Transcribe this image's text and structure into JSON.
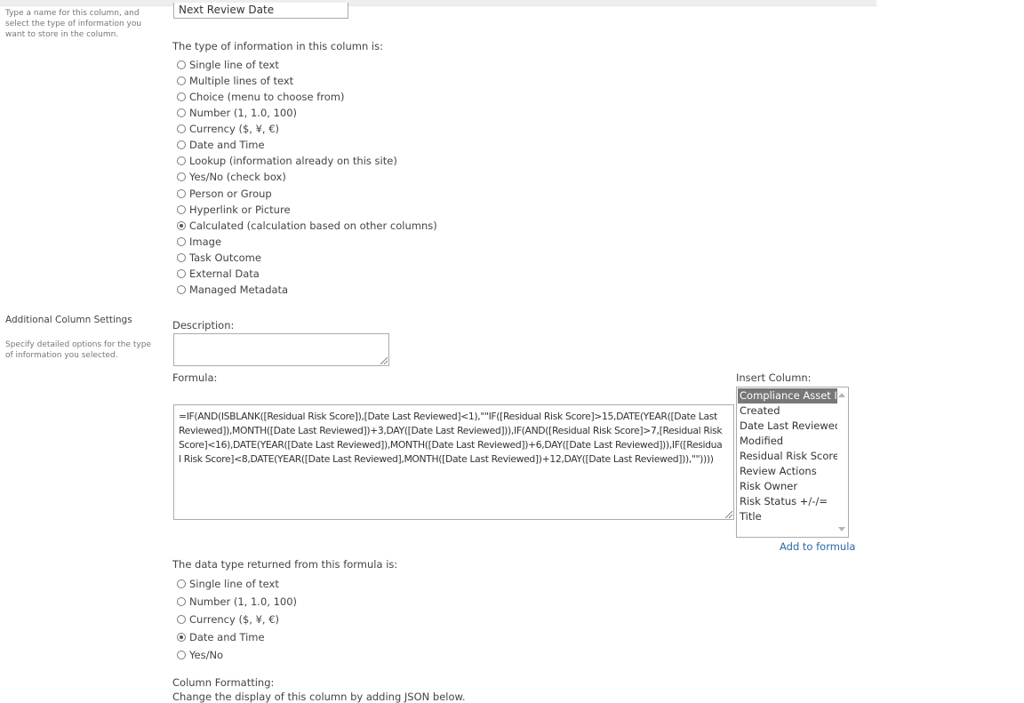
{
  "name_section": {
    "description": "Type a name for this column, and select the type of information you want to store in the column.",
    "column_name_value": "Next Review Date"
  },
  "type_section": {
    "label": "The type of information in this column is:",
    "options": [
      {
        "label": "Single line of text",
        "checked": false
      },
      {
        "label": "Multiple lines of text",
        "checked": false
      },
      {
        "label": "Choice (menu to choose from)",
        "checked": false
      },
      {
        "label": "Number (1, 1.0, 100)",
        "checked": false
      },
      {
        "label": "Currency ($, ¥, €)",
        "checked": false
      },
      {
        "label": "Date and Time",
        "checked": false
      },
      {
        "label": "Lookup (information already on this site)",
        "checked": false
      },
      {
        "label": "Yes/No (check box)",
        "checked": false
      },
      {
        "label": "Person or Group",
        "checked": false
      },
      {
        "label": "Hyperlink or Picture",
        "checked": false
      },
      {
        "label": "Calculated (calculation based on other columns)",
        "checked": true
      },
      {
        "label": "Image",
        "checked": false
      },
      {
        "label": "Task Outcome",
        "checked": false
      },
      {
        "label": "External Data",
        "checked": false
      },
      {
        "label": "Managed Metadata",
        "checked": false
      }
    ]
  },
  "additional_settings": {
    "heading": "Additional Column Settings",
    "description": "Specify detailed options for the type of information you selected.",
    "description_label": "Description:",
    "description_value": "",
    "formula_label": "Formula:",
    "formula_value": "=IF(AND(ISBLANK([Residual Risk Score]),[Date Last Reviewed]<1),\"\"IF([Residual Risk Score]>15,DATE(YEAR([Date Last Reviewed]),MONTH([Date Last Reviewed])+3,DAY([Date Last Reviewed])),IF(AND([Residual Risk Score]>7,[Residual Risk Score]<16),DATE(YEAR([Date Last Reviewed]),MONTH([Date Last Reviewed])+6,DAY([Date Last Reviewed])),IF([Residual Risk Score]<8,DATE(YEAR([Date Last Reviewed],MONTH([Date Last Reviewed])+12,DAY([Date Last Reviewed])),\"\"))))",
    "insert_column_label": "Insert Column:",
    "insert_columns": [
      {
        "label": "Compliance Asset Id",
        "selected": true
      },
      {
        "label": "Created",
        "selected": false
      },
      {
        "label": "Date Last Reviewed",
        "selected": false
      },
      {
        "label": "Modified",
        "selected": false
      },
      {
        "label": "Residual Risk Score",
        "selected": false
      },
      {
        "label": "Review Actions",
        "selected": false
      },
      {
        "label": "Risk Owner",
        "selected": false
      },
      {
        "label": "Risk Status +/-/=",
        "selected": false
      },
      {
        "label": "Title",
        "selected": false
      }
    ],
    "add_to_formula_link": "Add to formula",
    "return_type_label": "The data type returned from this formula is:",
    "return_types": [
      {
        "label": "Single line of text",
        "checked": false
      },
      {
        "label": "Number (1, 1.0, 100)",
        "checked": false
      },
      {
        "label": "Currency ($, ¥, €)",
        "checked": false
      },
      {
        "label": "Date and Time",
        "checked": true
      },
      {
        "label": "Yes/No",
        "checked": false
      }
    ],
    "column_formatting_label": "Column Formatting:",
    "column_formatting_hint": "Change the display of this column by adding JSON below."
  }
}
